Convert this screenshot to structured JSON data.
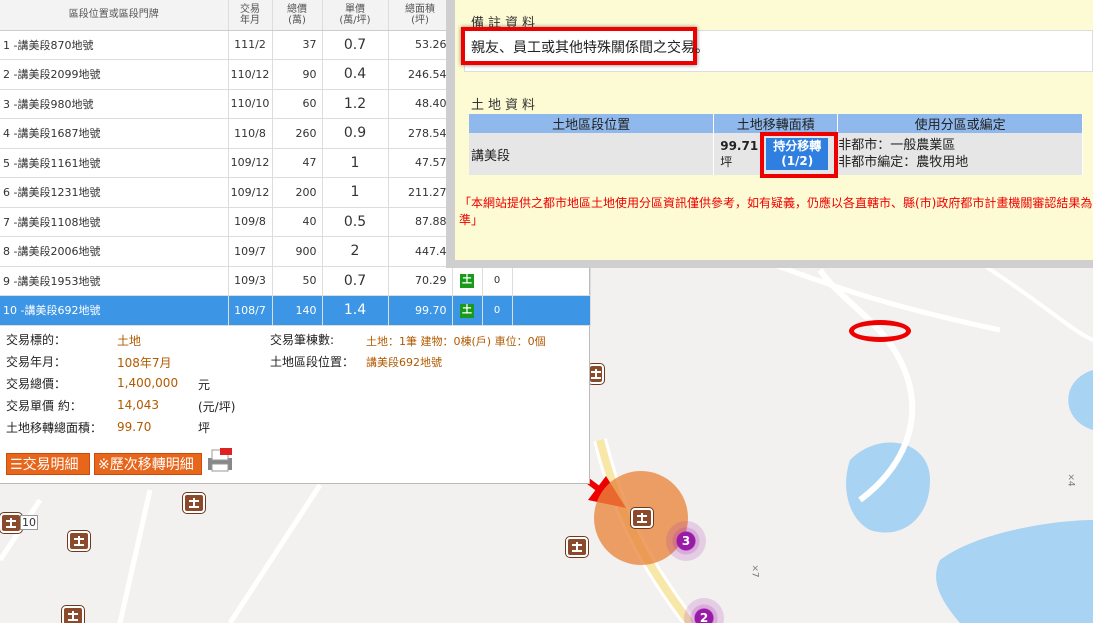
{
  "table": {
    "headers": {
      "address": [
        "區段位置或區段門牌"
      ],
      "date": [
        "交易",
        "年月"
      ],
      "total": [
        "總價",
        "(萬)"
      ],
      "unit": [
        "單價",
        "(萬/坪)"
      ],
      "area": [
        "總面積",
        "(坪)"
      ]
    },
    "rows": [
      {
        "addr": "1 -講美段870地號",
        "date": "111/2",
        "total": "37",
        "unit": "0.7",
        "area": "53.26"
      },
      {
        "addr": "2 -講美段2099地號",
        "date": "110/12",
        "total": "90",
        "unit": "0.4",
        "area": "246.54"
      },
      {
        "addr": "3 -講美段980地號",
        "date": "110/10",
        "total": "60",
        "unit": "1.2",
        "area": "48.40"
      },
      {
        "addr": "4 -講美段1687地號",
        "date": "110/8",
        "total": "260",
        "unit": "0.9",
        "area": "278.54"
      },
      {
        "addr": "5 -講美段1161地號",
        "date": "109/12",
        "total": "47",
        "unit": "1",
        "area": "47.57"
      },
      {
        "addr": "6 -講美段1231地號",
        "date": "109/12",
        "total": "200",
        "unit": "1",
        "area": "211.27"
      },
      {
        "addr": "7 -講美段1108地號",
        "date": "109/8",
        "total": "40",
        "unit": "0.5",
        "area": "87.88"
      },
      {
        "addr": "8 -講美段2006地號",
        "date": "109/7",
        "total": "900",
        "unit": "2",
        "area": "447.4"
      },
      {
        "addr": "9 -講美段1953地號",
        "date": "109/3",
        "total": "50",
        "unit": "0.7",
        "area": "70.29",
        "type": "土",
        "count": "0"
      },
      {
        "addr": "10 -講美段692地號",
        "date": "108/7",
        "total": "140",
        "unit": "1.4",
        "area": "99.70",
        "type": "土",
        "count": "0"
      }
    ]
  },
  "detail": {
    "target_label": "交易標的：",
    "target_value": "土地",
    "ym_label": "交易年月：",
    "ym_value": "108年7月",
    "total_label": "交易總價：",
    "total_value": "1,400,000",
    "total_unit": "元",
    "unit_label": "交易單價 約：",
    "unit_value": "14,043",
    "unit_unit": "(元/坪)",
    "area_label": "土地移轉總面積：",
    "area_value": "99.70",
    "area_unit": "坪",
    "count_label": "交易筆棟數:",
    "count_value": "土地：1筆 建物：0棟(戶) 車位：0個",
    "pos_label": "土地區段位置：",
    "pos_value": "講美段692地號",
    "btn_detail": "交易明細",
    "btn_history": "※歷次移轉明細"
  },
  "remark": {
    "title": "備註資料",
    "text": "親友、員工或其他特殊關係間之交易。"
  },
  "land": {
    "title": "土地資料",
    "headers": [
      "土地區段位置",
      "土地移轉面積",
      "使用分區或編定"
    ],
    "section": "講美段",
    "area_value": "99.71",
    "area_unit": "坪",
    "share_btn": [
      "持分移轉",
      "(1/2)"
    ],
    "zoning": [
      "非都市：一般農業區",
      "非都市編定：農牧用地"
    ]
  },
  "disclaimer": "「本網站提供之都市地區土地使用分區資訊僅供參考，如有疑義，仍應以各直轄市、縣(市)政府都市計畫機關審認結果為準」",
  "map": {
    "cluster_1": "3",
    "cluster_2": "2",
    "marker_label": "10",
    "land_glyph": "土",
    "grid_mark_1": "×4",
    "grid_mark_2": "×7"
  },
  "colors": {
    "selected_row": "#3c95e5",
    "accent_orange": "#e8661b",
    "highlight_red": "#ee0000",
    "remark_bg": "#fdfbd3"
  }
}
